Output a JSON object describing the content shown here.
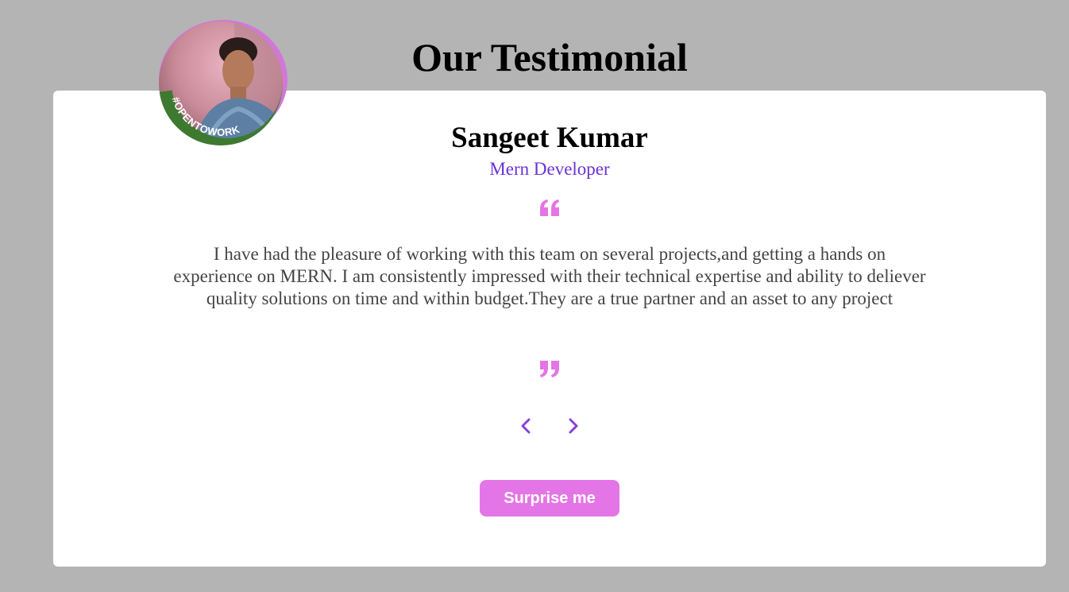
{
  "page": {
    "title": "Our Testimonial"
  },
  "testimonial": {
    "name": "Sangeet Kumar",
    "role": "Mern Developer",
    "text": "I have had the pleasure of working with this team on several projects,and getting a hands on experience on MERN. I am consistently impressed with their technical expertise and ability to deliever quality solutions on time and within budget.They are a true partner and an asset to any project",
    "avatar_badge": "#OPENTOWORK"
  },
  "controls": {
    "surprise_label": "Surprise me"
  },
  "icons": {
    "quote_open": "quote-open-icon",
    "quote_close": "quote-close-icon",
    "prev": "chevron-left-icon",
    "next": "chevron-right-icon"
  },
  "colors": {
    "background": "#b4b4b4",
    "card": "#ffffff",
    "role_text": "#6b32d6",
    "quote_marks": "#e475e6",
    "chevrons": "#8a3fd8",
    "button": "#e475e6",
    "button_text": "#ffffff",
    "avatar_ring": "#d277d8",
    "badge_green": "#3d7a2f"
  }
}
